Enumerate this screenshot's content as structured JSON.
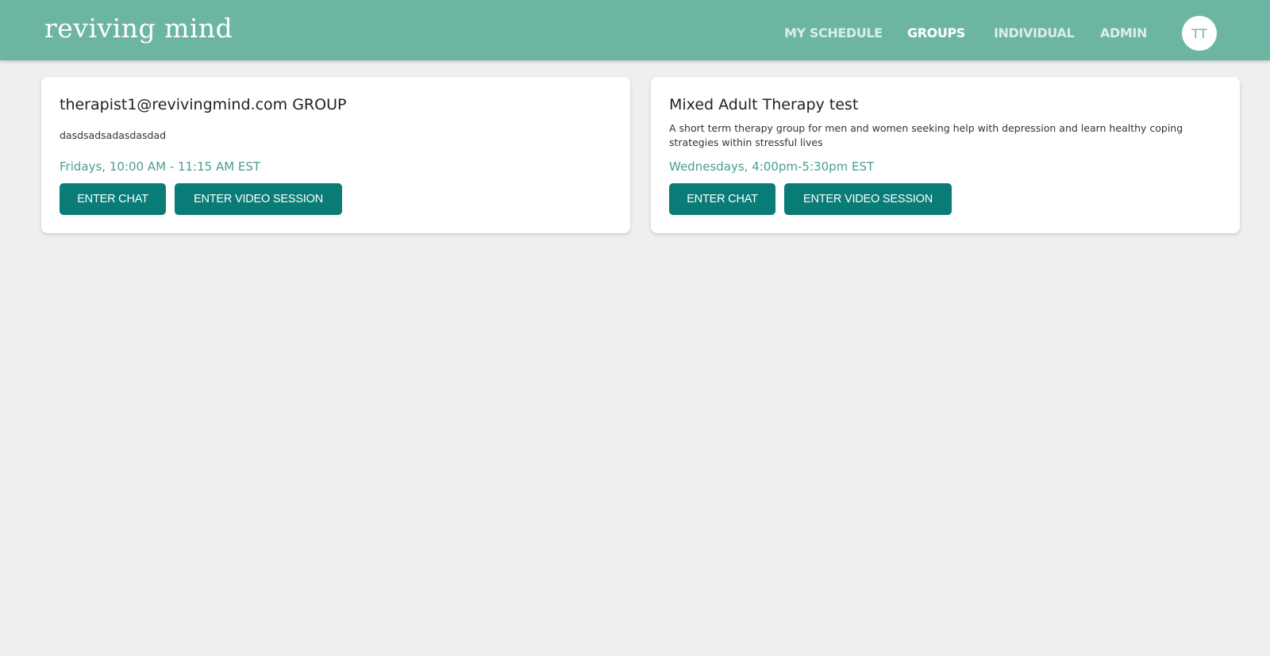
{
  "header": {
    "logo": "reviving mind",
    "nav": [
      {
        "label": "MY SCHEDULE",
        "active": false
      },
      {
        "label": "GROUPS",
        "active": true
      },
      {
        "label": "INDIVIDUAL",
        "active": false
      },
      {
        "label": "ADMIN",
        "active": false
      }
    ],
    "avatar_initials": "TT"
  },
  "groups": [
    {
      "title": "therapist1@revivingmind.com GROUP",
      "description": "dasdsadsadasdasdad",
      "schedule": "Fridays, 10:00 AM - 11:15 AM EST",
      "chat_label": "ENTER CHAT",
      "video_label": "ENTER VIDEO SESSION"
    },
    {
      "title": "Mixed Adult Therapy test",
      "description": "A short term therapy group for men and women seeking help with depression and learn healthy coping strategies within stressful lives",
      "schedule": "Wednesdays, 4:00pm-5:30pm EST",
      "chat_label": "ENTER CHAT",
      "video_label": "ENTER VIDEO SESSION"
    }
  ],
  "colors": {
    "header_bg": "#6db5a3",
    "button_bg": "#0a7c78",
    "schedule_text": "#4a9d94",
    "page_bg": "#efefef"
  }
}
